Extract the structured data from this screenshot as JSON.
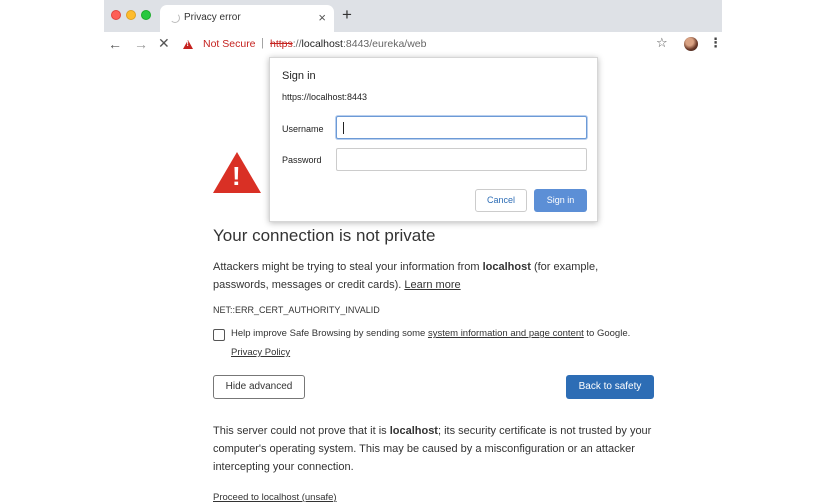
{
  "browser": {
    "tab_title": "Privacy error",
    "tab_close": "×",
    "new_tab": "+",
    "back": "←",
    "forward": "→",
    "stop": "✕",
    "security_label": "Not Secure",
    "separator": "|",
    "url_scheme": "https",
    "url_sep": "://",
    "url_host": "localhost",
    "url_rest": ":8443/eureka/web",
    "bookmark": "☆",
    "menu": "⋮",
    "icons": [
      "spinner-icon",
      "warning-icon",
      "star-icon",
      "avatar",
      "menu-icon"
    ]
  },
  "dialog": {
    "title": "Sign in",
    "origin": "https://localhost:8443",
    "username_label": "Username",
    "username_value": "",
    "password_label": "Password",
    "password_value": "",
    "cancel_label": "Cancel",
    "signin_label": "Sign in"
  },
  "page": {
    "heading": "Your connection is not private",
    "para_pre": "Attackers might be trying to steal your information from ",
    "para_host": "localhost",
    "para_post": " (for example, passwords, messages or credit cards). ",
    "learn_more": "Learn more",
    "error_code": "NET::ERR_CERT_AUTHORITY_INVALID",
    "safe_browsing_pre": "Help improve Safe Browsing by sending some ",
    "safe_browsing_link": "system information and page content",
    "safe_browsing_post": " to Google.",
    "privacy_policy": "Privacy Policy",
    "hide_advanced": "Hide advanced",
    "back_to_safety": "Back to safety",
    "details_pre": "This server could not prove that it is ",
    "details_host": "localhost",
    "details_post": "; its security certificate is not trusted by your computer's operating system. This may be caused by a misconfiguration or an attacker intercepting your connection.",
    "proceed": "Proceed to localhost (unsafe)"
  },
  "colors": {
    "warning_red": "#d93025",
    "primary_blue": "#2d6db5",
    "signin_blue": "#5c8fd6"
  }
}
